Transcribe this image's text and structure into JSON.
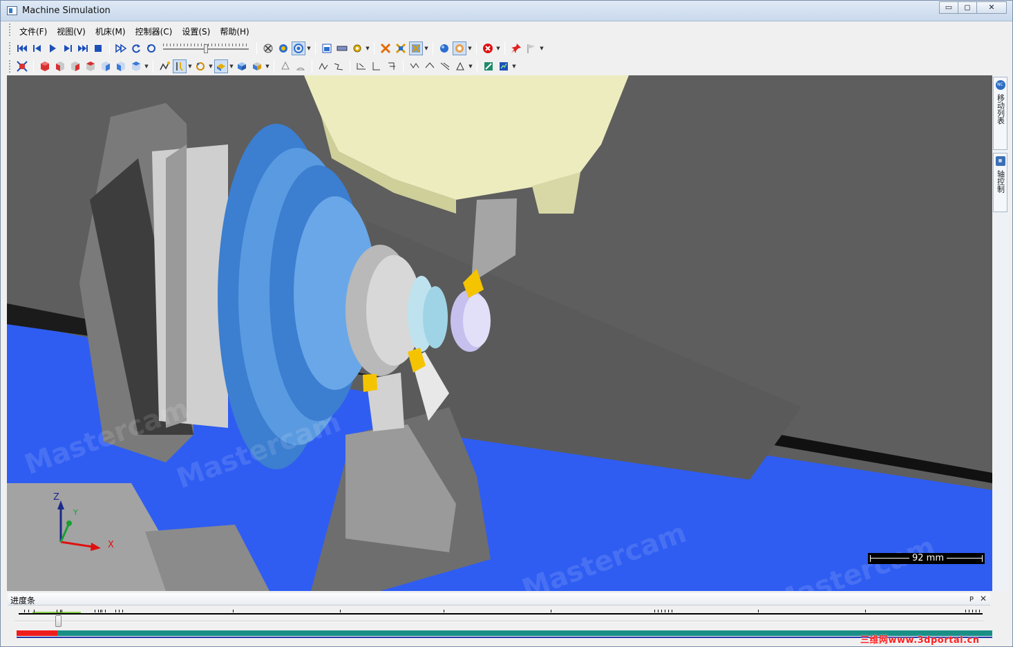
{
  "window": {
    "title": "Machine Simulation",
    "minimize_glyph": "▭",
    "maximize_glyph": "◻",
    "close_glyph": "✕"
  },
  "menu": {
    "items": [
      "文件(F)",
      "视图(V)",
      "机床(M)",
      "控制器(C)",
      "设置(S)",
      "帮助(H)"
    ]
  },
  "toolbar1": {
    "playback": [
      "first-icon",
      "step-back-icon",
      "play-icon",
      "step-forward-icon",
      "last-icon",
      "stop-icon"
    ],
    "speed_slider_value": 0.5
  },
  "viewport": {
    "axis_labels": {
      "z": "Z",
      "y": "Y",
      "x": "X"
    },
    "scale_label": "92 mm",
    "watermark": "Mastercam",
    "colors": {
      "background": "#5c5c5c",
      "floor": "#2d5bf0",
      "spindle_blue": "#4e8fd6",
      "head": "#ececc0",
      "insert": "#f5c400"
    }
  },
  "sidepanel": {
    "tabs": [
      {
        "icon": "NC",
        "label": "移动列表"
      },
      {
        "icon": "▦",
        "label": "轴控制"
      }
    ]
  },
  "progress": {
    "title": "进度条",
    "pin_glyph": "ᴘ",
    "close_glyph": "✕",
    "fraction": 0.042
  },
  "credit": "三维网www.3dportal.cn"
}
